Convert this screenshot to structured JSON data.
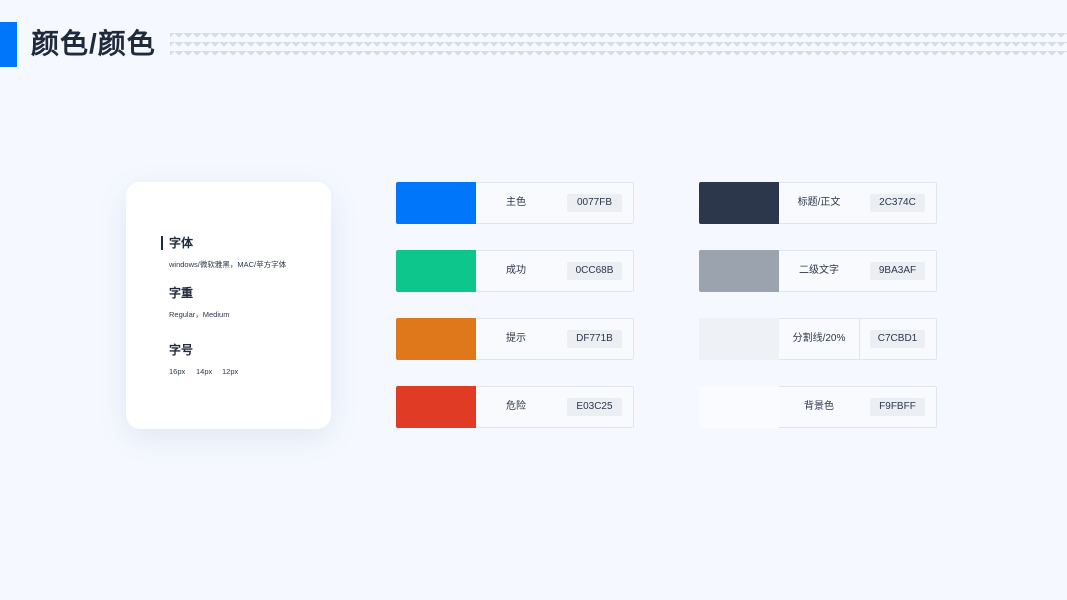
{
  "header": {
    "title": "颜色/颜色"
  },
  "font_card": {
    "font_heading": "字体",
    "font_desc": "windows/微软雅黑，MAC/苹方字体",
    "weight_heading": "字重",
    "weight_desc": "Regular，Medium",
    "size_heading": "字号",
    "sizes": [
      "16px",
      "14px",
      "12px"
    ]
  },
  "colors_left": [
    {
      "name": "主色",
      "hex": "0077FB",
      "swatch": "#0077FB"
    },
    {
      "name": "成功",
      "hex": "0CC68B",
      "swatch": "#0CC68B"
    },
    {
      "name": "提示",
      "hex": "DF771B",
      "swatch": "#DF771B"
    },
    {
      "name": "危险",
      "hex": "E03C25",
      "swatch": "#E03C25"
    }
  ],
  "colors_right": [
    {
      "name": "标题/正文",
      "hex": "2C374C",
      "swatch": "#2C374C"
    },
    {
      "name": "二级文字",
      "hex": "9BA3AF",
      "swatch": "#9BA3AF"
    },
    {
      "name": "分割线/20%",
      "hex": "C7CBD1",
      "swatch": "#EEF1F5"
    },
    {
      "name": "背景色",
      "hex": "F9FBFF",
      "swatch": "#F9FBFF"
    }
  ]
}
